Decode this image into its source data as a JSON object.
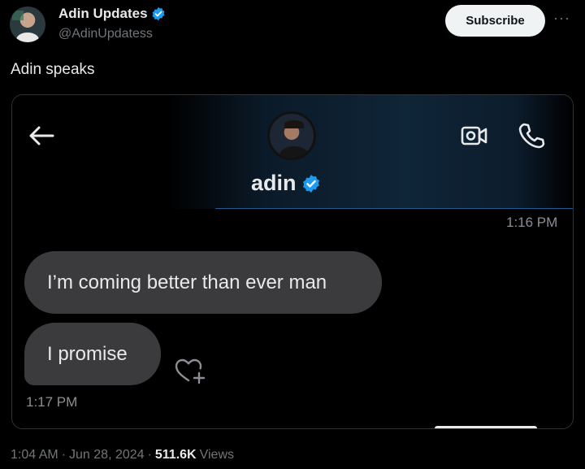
{
  "author": {
    "name": "Adin Updates",
    "handle": "@AdinUpdatess",
    "verified_color": "#1d9bf0"
  },
  "header": {
    "subscribe_label": "Subscribe",
    "more_label": "···"
  },
  "tweet": {
    "text": "Adin speaks"
  },
  "media": {
    "chat_name": "adin",
    "icons": [
      "back-arrow-icon",
      "video-call-icon",
      "phone-call-icon",
      "heart-add-icon"
    ],
    "messages": [
      {
        "time": "1:16 PM",
        "text": "I’m coming better than ever man"
      },
      {
        "text": "I promise",
        "time": "1:17 PM"
      }
    ]
  },
  "meta": {
    "time": "1:04 AM",
    "sep1": "·",
    "date": "Jun 28, 2024",
    "sep2": "·",
    "views": "511.6K",
    "views_label": "Views"
  }
}
